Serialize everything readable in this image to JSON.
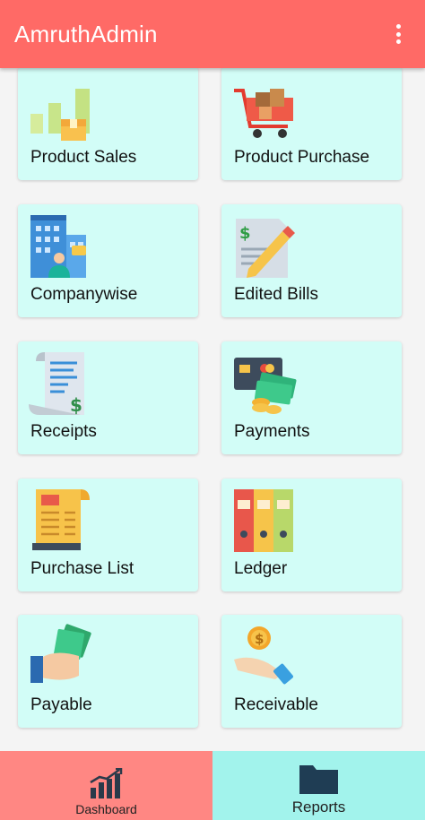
{
  "appbar": {
    "title": "AmruthAdmin",
    "menu_icon": "more-vert-icon"
  },
  "tiles": [
    {
      "label": "Product Sales",
      "icon": "sales-chart-box-icon"
    },
    {
      "label": "Product Purchase",
      "icon": "shopping-cart-icon"
    },
    {
      "label": "Companywise",
      "icon": "company-building-icon"
    },
    {
      "label": "Edited Bills",
      "icon": "edited-bill-pencil-icon"
    },
    {
      "label": "Receipts",
      "icon": "receipt-scroll-icon"
    },
    {
      "label": "Payments",
      "icon": "card-cash-icon"
    },
    {
      "label": "Purchase List",
      "icon": "purchase-list-icon"
    },
    {
      "label": "Ledger",
      "icon": "ledger-binders-icon"
    },
    {
      "label": "Payable",
      "icon": "hand-money-icon"
    },
    {
      "label": "Receivable",
      "icon": "hand-coin-icon"
    }
  ],
  "bottom_nav": {
    "dashboard": {
      "label": "Dashboard",
      "icon": "bar-chart-trend-icon"
    },
    "reports": {
      "label": "Reports",
      "icon": "folder-icon"
    }
  },
  "colors": {
    "appbar": "#ff6a66",
    "card": "#d2fdf7",
    "dashboard_tab": "#ff8783",
    "reports_tab": "#a2f3ec"
  }
}
